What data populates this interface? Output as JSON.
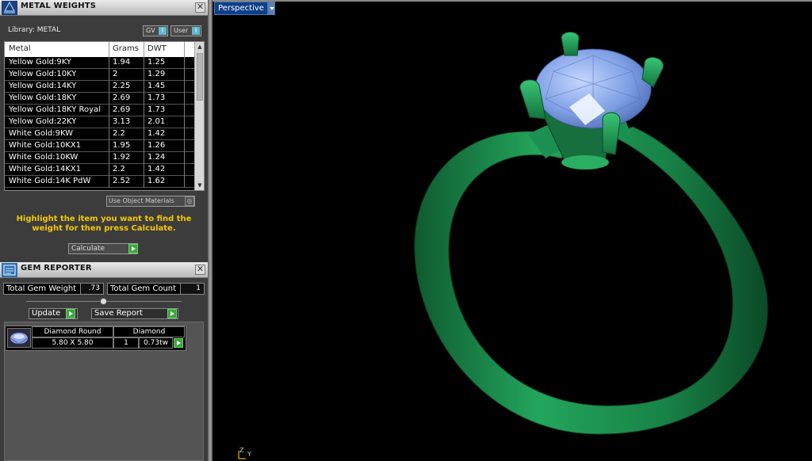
{
  "metal_weights": {
    "title": "METAL WEIGHTS",
    "close": "✕",
    "library_label": "Library: METAL",
    "gv_label": "GV",
    "gv_indicator": "I",
    "user_label": "User",
    "user_indicator": "I",
    "columns": [
      "Metal",
      "Grams",
      "DWT"
    ],
    "rows": [
      {
        "metal": "Yellow Gold:9KY",
        "grams": "1.94",
        "dwt": "1.25"
      },
      {
        "metal": "Yellow Gold:10KY",
        "grams": "2",
        "dwt": "1.29"
      },
      {
        "metal": "Yellow Gold:14KY",
        "grams": "2.25",
        "dwt": "1.45"
      },
      {
        "metal": "Yellow Gold:18KY",
        "grams": "2.69",
        "dwt": "1.73"
      },
      {
        "metal": "Yellow Gold:18KY Royal",
        "grams": "2.69",
        "dwt": "1.73"
      },
      {
        "metal": "Yellow Gold:22KY",
        "grams": "3.13",
        "dwt": "2.01"
      },
      {
        "metal": "White Gold:9KW",
        "grams": "2.2",
        "dwt": "1.42"
      },
      {
        "metal": "White Gold:10KX1",
        "grams": "1.95",
        "dwt": "1.26"
      },
      {
        "metal": "White Gold:10KW",
        "grams": "1.92",
        "dwt": "1.24"
      },
      {
        "metal": "White Gold:14KX1",
        "grams": "2.2",
        "dwt": "1.42"
      },
      {
        "metal": "White Gold:14K PdW",
        "grams": "2.52",
        "dwt": "1.62"
      }
    ],
    "use_object_materials": "Use Object Materials",
    "hint": "Highlight the item you want to find the weight for then press Calculate.",
    "calculate_label": "Calculate"
  },
  "gem_reporter": {
    "title": "GEM REPORTER",
    "close": "✕",
    "total_weight_label": "Total Gem Weight",
    "total_weight_value": ".73",
    "total_count_label": "Total Gem Count",
    "total_count_value": "1",
    "update_label": "Update",
    "save_report_label": "Save Report",
    "gem": {
      "shape": "Diamond Round",
      "size": "5.80 X 5.80",
      "type": "Diamond",
      "count": "1",
      "weight": "0.73tw"
    }
  },
  "viewport": {
    "view_label": "Perspective",
    "axis_z": "Z",
    "axis_y": "Y"
  },
  "colors": {
    "ring": "#1f8a4c",
    "gem": "#7aa0e6",
    "hint": "#f5c800",
    "view_tab": "#0d3f8a"
  }
}
